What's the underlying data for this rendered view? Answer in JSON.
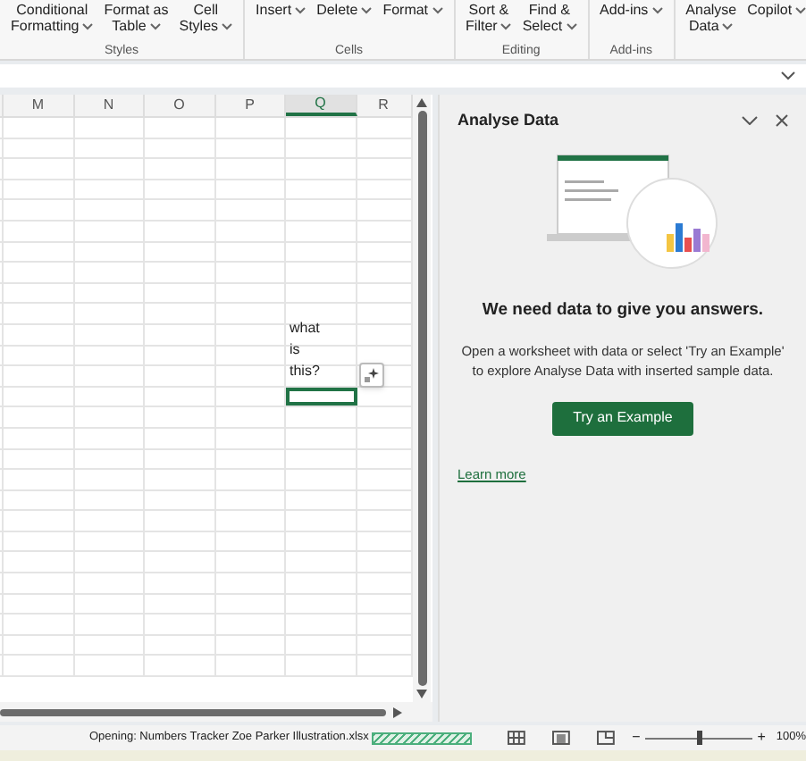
{
  "ribbon": {
    "groups": [
      {
        "label": "Styles",
        "buttons": [
          {
            "lines": [
              "Conditional",
              "Formatting"
            ]
          },
          {
            "lines": [
              "Format as",
              "Table"
            ]
          },
          {
            "lines": [
              "Cell",
              "Styles"
            ]
          }
        ]
      },
      {
        "label": "Cells",
        "buttons": [
          {
            "lines": [
              "Insert"
            ]
          },
          {
            "lines": [
              "Delete"
            ]
          },
          {
            "lines": [
              "Format"
            ]
          }
        ]
      },
      {
        "label": "Editing",
        "buttons": [
          {
            "lines": [
              "Sort &",
              "Filter"
            ]
          },
          {
            "lines": [
              "Find &",
              "Select"
            ]
          }
        ]
      },
      {
        "label": "Add-ins",
        "buttons": [
          {
            "lines": [
              "Add-ins"
            ]
          }
        ]
      },
      {
        "buttons": [
          {
            "lines": [
              "Analyse",
              "Data"
            ]
          },
          {
            "lines": [
              "Copilot"
            ]
          }
        ]
      }
    ]
  },
  "sheet": {
    "columns": [
      {
        "label": "M",
        "selected": false
      },
      {
        "label": "N",
        "selected": false
      },
      {
        "label": "O",
        "selected": false
      },
      {
        "label": "P",
        "selected": false
      },
      {
        "label": "Q",
        "selected": true
      },
      {
        "label": "R",
        "selected": false
      }
    ],
    "cells": [
      {
        "text": "what"
      },
      {
        "text": "is"
      },
      {
        "text": "this?"
      }
    ]
  },
  "pane": {
    "title": "Analyse Data",
    "heading": "We need data to give you answers.",
    "body": "Open a worksheet with data or select 'Try an Example' to explore Analyse Data with inserted sample data.",
    "button": "Try an Example",
    "link": "Learn more"
  },
  "status_bar": {
    "message": "Opening: Numbers Tracker Zoe Parker Illustration.xlsx",
    "progress": {
      "level": 1
    },
    "zoom": {
      "minus": "−",
      "plus": "+",
      "level": 0.5,
      "reading": "100%"
    }
  }
}
